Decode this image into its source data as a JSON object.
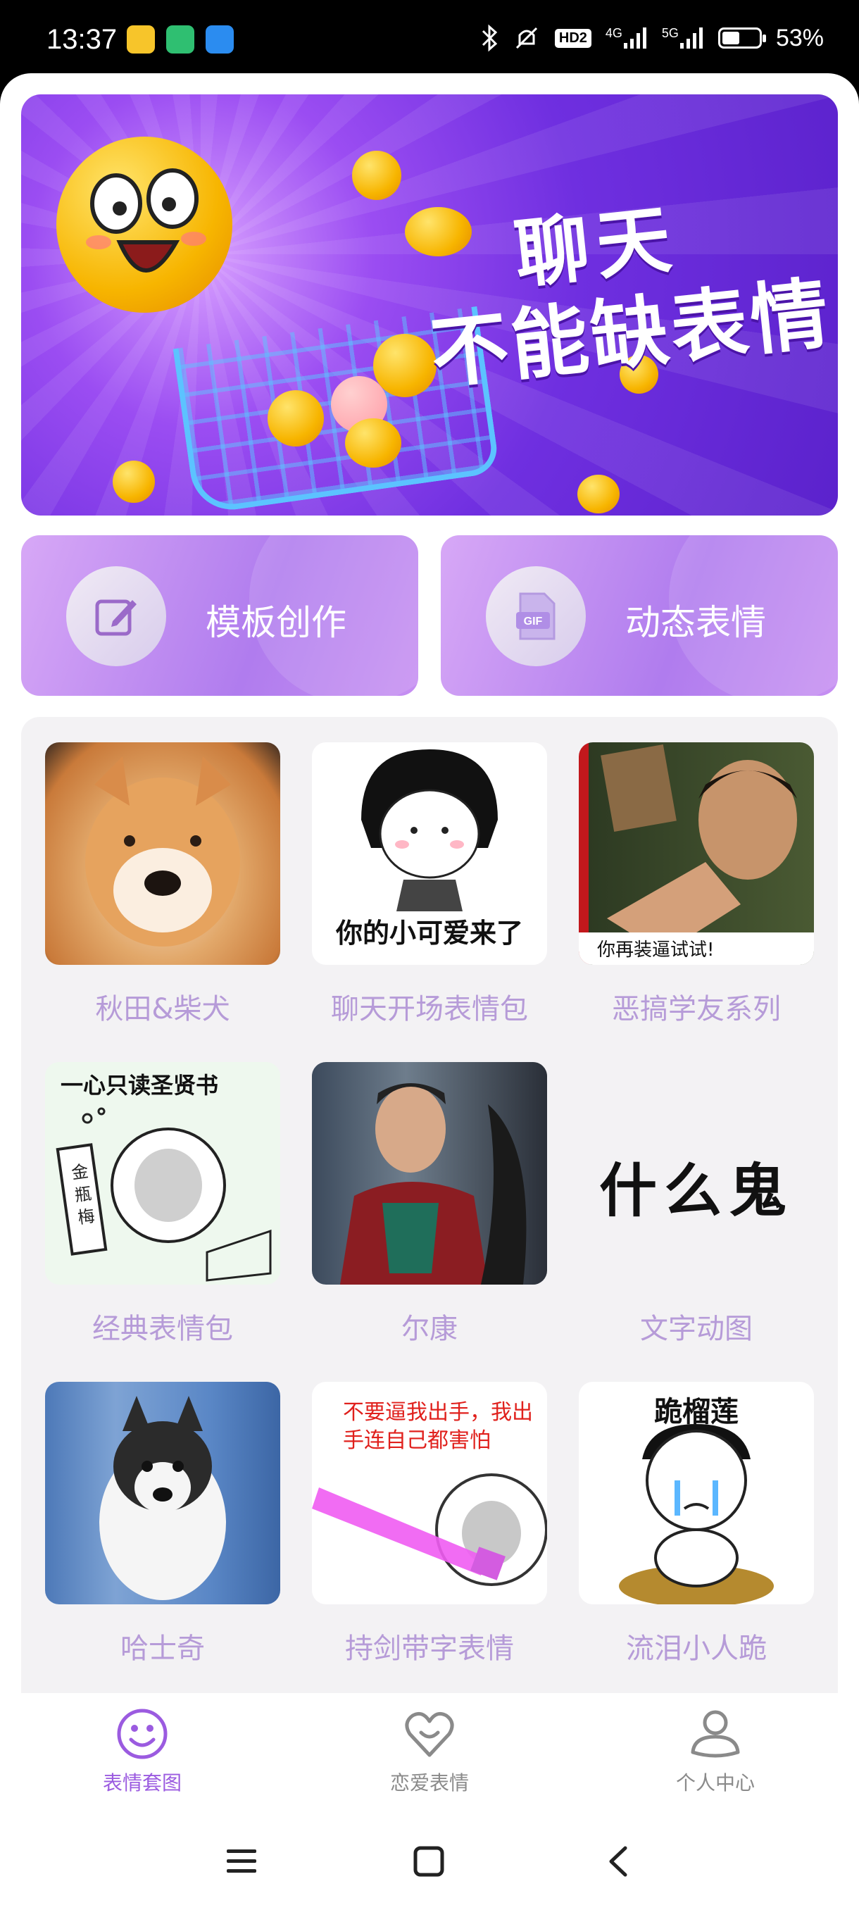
{
  "status": {
    "time": "13:37",
    "battery_percent": "53%",
    "battery_level": 0.53,
    "network_1": "4G",
    "network_2": "5G",
    "hd": "HD2"
  },
  "banner": {
    "line1": "聊天",
    "line2": "不能缺表情"
  },
  "actions": [
    {
      "label": "模板创作",
      "icon": "edit-icon"
    },
    {
      "label": "动态表情",
      "icon": "gif-icon"
    }
  ],
  "grid": [
    {
      "caption": "秋田&柴犬",
      "image": "shiba-dog-photo"
    },
    {
      "caption": "聊天开场表情包",
      "image": "cartoon-girl-sticker",
      "overlay": "你的小可爱来了"
    },
    {
      "caption": "恶搞学友系列",
      "image": "actor-pointing-photo",
      "overlay": "你再装逼试试!"
    },
    {
      "caption": "经典表情包",
      "image": "meme-face-drawing",
      "overlay": "一心只读圣贤书",
      "scroll_text": "金瓶梅"
    },
    {
      "caption": "尔康",
      "image": "drama-still-photo"
    },
    {
      "caption": "文字动图",
      "image": "text-gif",
      "overlay": "什么鬼"
    },
    {
      "caption": "哈士奇",
      "image": "husky-puppy-photo"
    },
    {
      "caption": "持剑带字表情",
      "image": "sword-meme",
      "overlay": "不要逼我出手，我出手连自己都害怕"
    },
    {
      "caption": "流泪小人跪",
      "image": "crying-kneel-sticker",
      "overlay": "跪榴莲"
    }
  ],
  "tabs": [
    {
      "label": "表情套图",
      "icon": "smiley-icon",
      "active": true
    },
    {
      "label": "恋爱表情",
      "icon": "heart-icon",
      "active": false
    },
    {
      "label": "个人中心",
      "icon": "person-icon",
      "active": false
    }
  ],
  "colors": {
    "accent": "#9b5be0",
    "caption": "#b69bd8",
    "inactive": "#8a8a8a"
  }
}
